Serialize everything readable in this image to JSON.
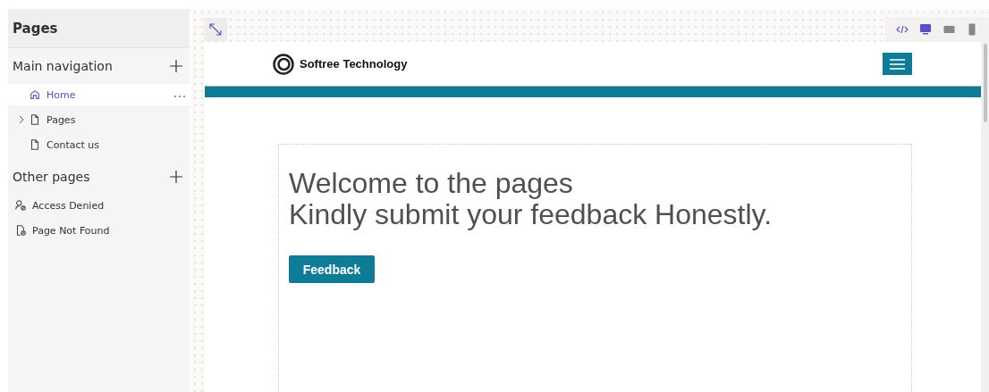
{
  "sidebar": {
    "title": "Pages",
    "sections": [
      {
        "title": "Main navigation",
        "items": [
          {
            "label": "Home",
            "kind": "home",
            "selected": true
          },
          {
            "label": "Pages",
            "kind": "page",
            "selected": false,
            "expanded": false
          },
          {
            "label": "Contact us",
            "kind": "page",
            "selected": false
          }
        ]
      },
      {
        "title": "Other pages",
        "items": [
          {
            "label": "Access Denied",
            "kind": "person",
            "selected": false
          },
          {
            "label": "Page Not Found",
            "kind": "missing",
            "selected": false
          }
        ]
      }
    ]
  },
  "devices": [
    {
      "kind": "code",
      "selected": false
    },
    {
      "kind": "desktop",
      "selected": true
    },
    {
      "kind": "tablet",
      "selected": false
    },
    {
      "kind": "phone",
      "selected": false
    }
  ],
  "preview": {
    "brand": "Softree Technology",
    "heading": [
      "Welcome to the pages",
      "Kindly submit your feedback Honestly."
    ],
    "button": "Feedback"
  }
}
